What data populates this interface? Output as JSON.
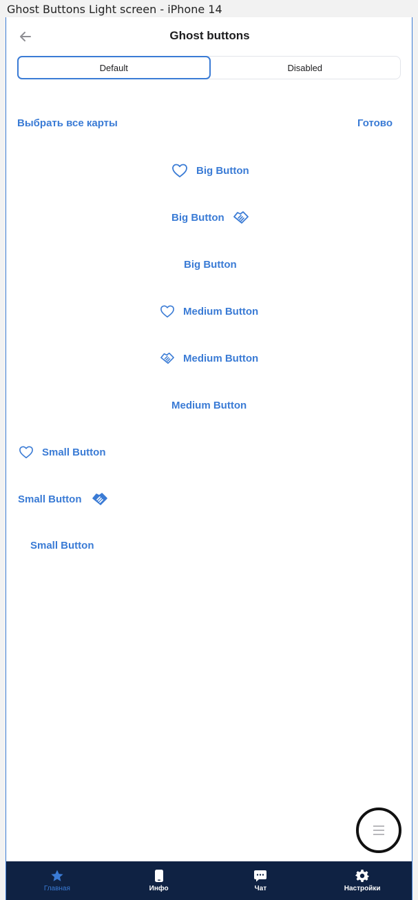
{
  "frame": {
    "title": "Ghost Buttons Light screen - iPhone 14"
  },
  "header": {
    "title": "Ghost buttons"
  },
  "segmented": {
    "default_label": "Default",
    "disabled_label": "Disabled",
    "selected": "Default"
  },
  "links": {
    "select_all": "Выбрать все карты",
    "done": "Готово"
  },
  "buttons": {
    "big_1": "Big Button",
    "big_2": "Big Button",
    "big_3": "Big Button",
    "medium_1": "Medium Button",
    "medium_2": "Medium Button",
    "medium_3": "Medium Button",
    "small_1": "Small Button",
    "small_2": "Small Button",
    "small_3": "Small Button"
  },
  "icons": {
    "back": "arrow-left-icon",
    "heart": "heart-icon",
    "handshake": "handshake-icon",
    "menu": "menu-icon"
  },
  "tabbar": {
    "items": [
      {
        "label": "Главная",
        "icon": "star-icon",
        "active": true
      },
      {
        "label": "Инфо",
        "icon": "phone-icon",
        "active": false
      },
      {
        "label": "Чат",
        "icon": "chat-icon",
        "active": false
      },
      {
        "label": "Настройки",
        "icon": "gear-icon",
        "active": false
      }
    ]
  },
  "colors": {
    "accent": "#3a7bd5",
    "tabbar_bg": "#0f2243",
    "text": "#1c1c1e"
  }
}
